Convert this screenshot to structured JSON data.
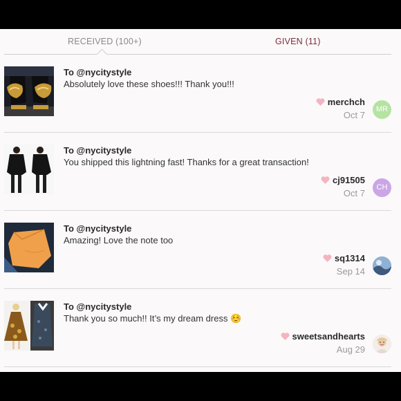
{
  "tabs": {
    "received": "RECEIVED (100+)",
    "given": "GIVEN (11)",
    "active": "received"
  },
  "colors": {
    "given_tab": "#7b2d3f",
    "heart": "#f4b4bf",
    "avatar_mr": "#b5e3a2",
    "avatar_ch": "#cba6e6"
  },
  "items": [
    {
      "to": "To @nycitystyle",
      "message": "Absolutely love these shoes!!! Thank you!!!",
      "username": "merchch",
      "date": "Oct 7",
      "avatar_initials": "MR",
      "thumbnail": "black-gold-shoes"
    },
    {
      "to": "To @nycitystyle",
      "message": "You shipped this lightning fast! Thanks for a great transaction!",
      "username": "cj91505",
      "date": "Oct 7",
      "avatar_initials": "CH",
      "thumbnail": "black-top-model"
    },
    {
      "to": "To @nycitystyle",
      "message": "Amazing! Love the note too",
      "username": "sq1314",
      "date": "Sep 14",
      "avatar_initials": "",
      "thumbnail": "orange-shirt"
    },
    {
      "to": "To @nycitystyle",
      "message": "Thank you so much!! It’s my dream dress ☺️",
      "username": "sweetsandhearts",
      "date": "Aug 29",
      "avatar_initials": "",
      "thumbnail": "floral-dress"
    }
  ]
}
